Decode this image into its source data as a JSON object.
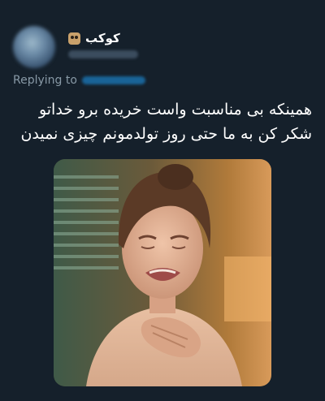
{
  "author": {
    "display_name": "کوکب",
    "emoji_icon": "owl-icon"
  },
  "reply": {
    "label": "Replying to"
  },
  "tweet": {
    "lines": [
      "همینکه بی مناسبت واست خریده برو خداتو",
      "شکر کن به ما حتی روز تولدمونم چیزی نمیدن"
    ]
  },
  "media": {
    "description_icon": "crying-woman-photo"
  },
  "colors": {
    "background": "#15202b",
    "text": "#ffffff",
    "muted": "#8899a6",
    "link": "#1d9bf0"
  }
}
